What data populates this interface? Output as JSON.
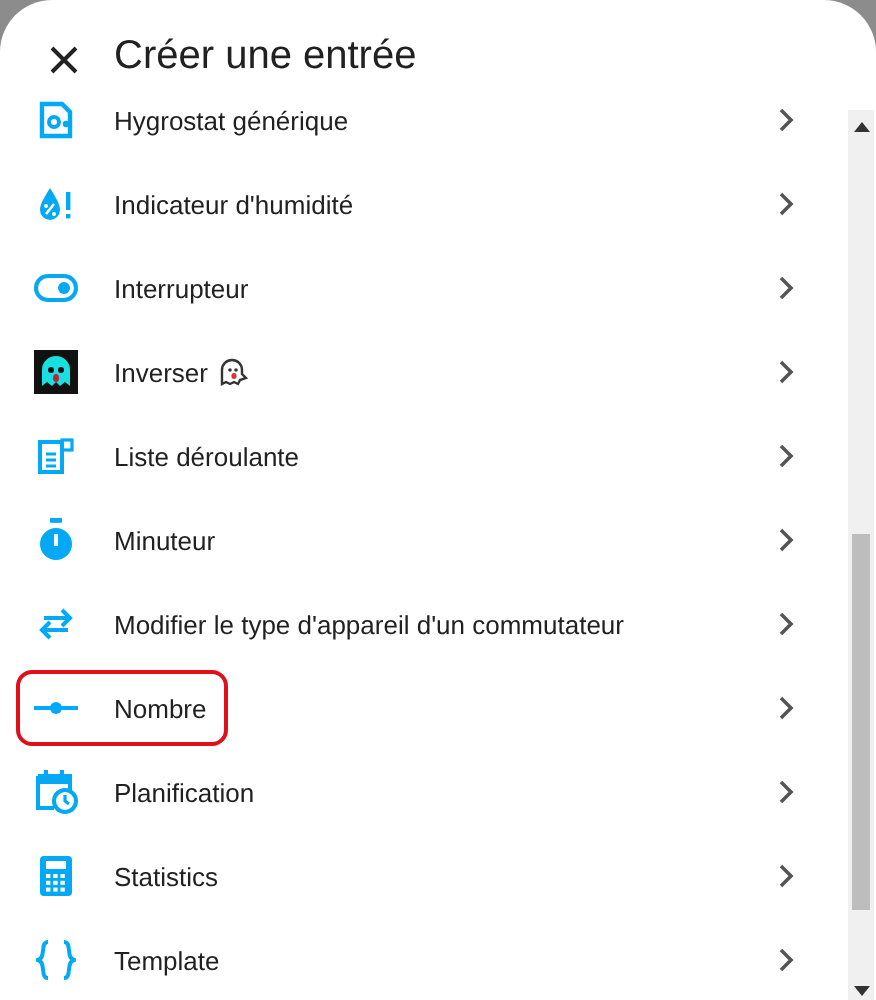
{
  "dialog": {
    "title": "Créer une entrée"
  },
  "items": [
    {
      "label": "Hygrostat générique",
      "highlighted": false
    },
    {
      "label": "Indicateur d'humidité",
      "highlighted": false
    },
    {
      "label": "Interrupteur",
      "highlighted": false
    },
    {
      "label": "Inverser",
      "highlighted": false
    },
    {
      "label": "Liste déroulante",
      "highlighted": false
    },
    {
      "label": "Minuteur",
      "highlighted": false
    },
    {
      "label": "Modifier le type d'appareil d'un commutateur",
      "highlighted": false
    },
    {
      "label": "Nombre",
      "highlighted": true
    },
    {
      "label": "Planification",
      "highlighted": false
    },
    {
      "label": "Statistics",
      "highlighted": false
    },
    {
      "label": "Template",
      "highlighted": false
    }
  ]
}
